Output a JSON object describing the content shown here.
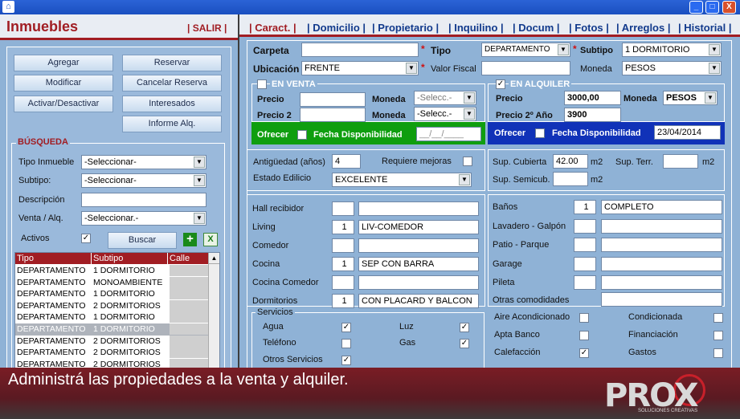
{
  "window": {
    "icon": "home-icon",
    "minimize": "_",
    "maximize": "□",
    "close": "X"
  },
  "left": {
    "title": "Inmuebles",
    "salir": "| SALIR |",
    "buttons": {
      "agregar": "Agregar",
      "reservar": "Reservar",
      "modificar": "Modificar",
      "cancelar_reserva": "Cancelar Reserva",
      "activar": "Activar/Desactivar",
      "interesados": "Interesados",
      "informe": "Informe Alq."
    },
    "search": {
      "title": "BÚSQUEDA",
      "tipo_label": "Tipo Inmueble",
      "tipo_value": "-Seleccionar-",
      "subtipo_label": "Subtipo:",
      "subtipo_value": "-Seleccionar-",
      "desc_label": "Descripción",
      "desc_value": "",
      "venta_label": "Venta / Alq.",
      "venta_value": "-Seleccionar.-",
      "activos_label": "Activos",
      "activos_check": "✓",
      "buscar": "Buscar",
      "add_icon": "+",
      "excel_icon": "X"
    },
    "table": {
      "headers": [
        "Tipo",
        "Subtipo",
        "Calle"
      ],
      "rows": [
        [
          "DEPARTAMENTO",
          "1 DORMITORIO"
        ],
        [
          "DEPARTAMENTO",
          "MONOAMBIENTE"
        ],
        [
          "DEPARTAMENTO",
          "1 DORMITORIO"
        ],
        [
          "DEPARTAMENTO",
          "2 DORMITORIOS"
        ],
        [
          "DEPARTAMENTO",
          "1 DORMITORIO"
        ],
        [
          "DEPARTAMENTO",
          "1 DORMITORIO"
        ],
        [
          "DEPARTAMENTO",
          "2 DORMITORIOS"
        ],
        [
          "DEPARTAMENTO",
          "2 DORMITORIOS"
        ],
        [
          "DEPARTAMENTO",
          "2 DORMITORIOS"
        ]
      ],
      "selected_index": 5
    }
  },
  "tabs": [
    "| Caract. |",
    "| Domicilio |",
    "| Propietario |",
    "| Inquilino |",
    "| Docum |",
    "| Fotos |",
    "| Arreglos |",
    "| Historial |"
  ],
  "form": {
    "carpeta_label": "Carpeta",
    "tipo_label": "Tipo",
    "tipo_value": "DEPARTAMENTO",
    "subtipo_label": "Subtipo",
    "subtipo_value": "1 DORMITORIO",
    "ubicacion_label": "Ubicación",
    "ubicacion_value": "FRENTE",
    "valor_fiscal_label": "Valor Fiscal",
    "moneda_label": "Moneda",
    "moneda_value": "PESOS",
    "req": "*",
    "venta": {
      "title": "EN VENTA",
      "precio": "Precio",
      "precio2": "Precio 2",
      "moneda": "Moneda",
      "moneda_value": "-Selecc.-",
      "moneda2_value": "-Selecc.-",
      "ofrecer": "Ofrecer",
      "fecha_label": "Fecha Disponibilidad",
      "fecha_value": "__/__/____"
    },
    "alquiler": {
      "title": "EN ALQUILER",
      "check": "✓",
      "precio": "Precio",
      "precio_value": "3000,00",
      "moneda": "Moneda",
      "moneda_value": "PESOS",
      "precio2": "Precio 2º Año",
      "precio2_value": "3900",
      "ofrecer": "Ofrecer",
      "fecha_label": "Fecha Disponibilidad",
      "fecha_value": "23/04/2014"
    },
    "antiguedad_label": "Antigüedad (años)",
    "antiguedad_value": "4",
    "requiere_label": "Requiere mejoras",
    "estado_label": "Estado Edilicio",
    "estado_value": "EXCELENTE",
    "sup_cubierta_label": "Sup. Cubierta",
    "sup_cubierta_value": "42.00",
    "m2": "m2",
    "sup_terr_label": "Sup. Terr.",
    "sup_semi_label": "Sup. Semicub.",
    "rooms_left": [
      [
        "Hall recibidor",
        "",
        ""
      ],
      [
        "Living",
        "1",
        "LIV-COMEDOR"
      ],
      [
        "Comedor",
        "",
        ""
      ],
      [
        "Cocina",
        "1",
        "SEP CON BARRA"
      ],
      [
        "Cocina Comedor",
        "",
        ""
      ],
      [
        "Dormitorios",
        "1",
        "CON PLACARD Y BALCON"
      ]
    ],
    "rooms_right": [
      [
        "Baños",
        "1",
        "COMPLETO"
      ],
      [
        "Lavadero - Galpón",
        "",
        ""
      ],
      [
        "Patio - Parque",
        "",
        ""
      ],
      [
        "Garage",
        "",
        ""
      ],
      [
        "Pileta",
        "",
        ""
      ]
    ],
    "otras_label": "Otras comodidades",
    "servicios_title": "Servicios",
    "servicios": [
      [
        "Agua",
        "✓"
      ],
      [
        "Luz",
        "✓"
      ],
      [
        "Teléfono",
        ""
      ],
      [
        "Gas",
        "✓"
      ],
      [
        "Otros Servicios",
        "✓"
      ]
    ],
    "extras": [
      [
        "Aire Acondicionado",
        ""
      ],
      [
        "Condicionada",
        ""
      ],
      [
        "Apta Banco",
        ""
      ],
      [
        "Financiación",
        ""
      ],
      [
        "Calefacción",
        "✓"
      ],
      [
        "Gastos",
        ""
      ]
    ]
  },
  "footer": {
    "caption": "Administrá las propiedades a la venta y alquiler.",
    "logo": "PROX",
    "logo_sub": "SOLUCIONES CREATIVAS"
  }
}
